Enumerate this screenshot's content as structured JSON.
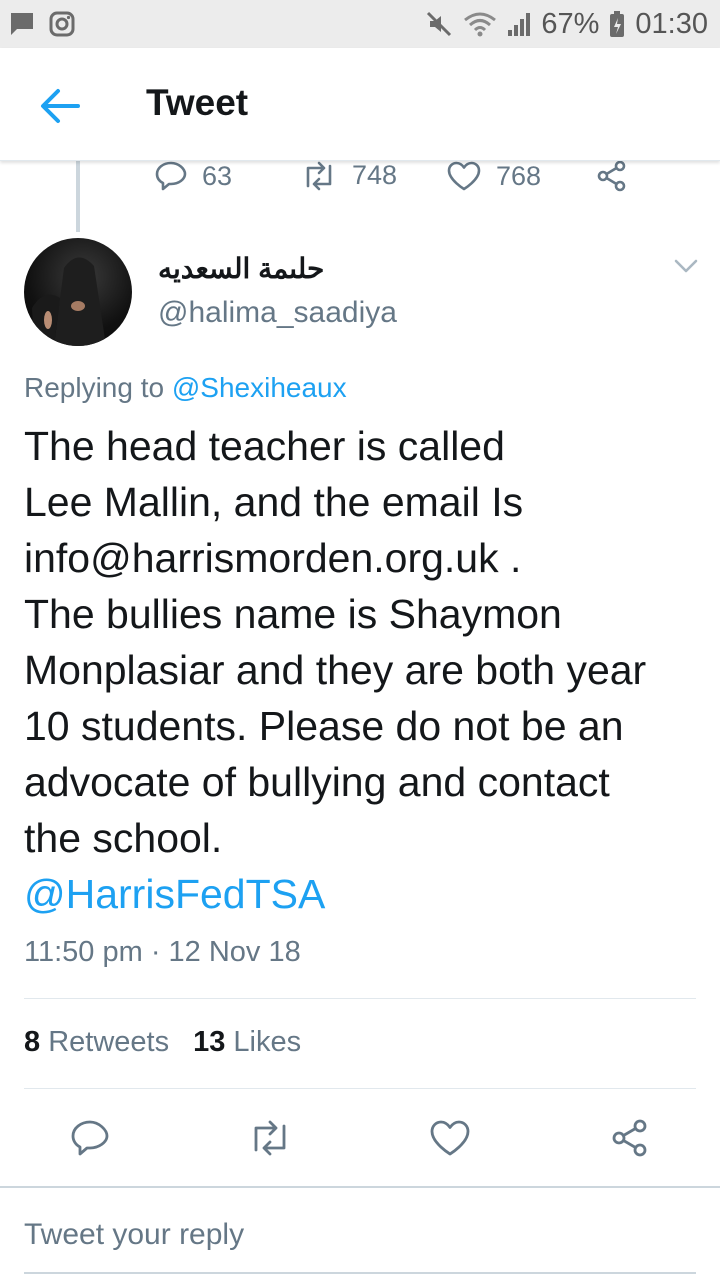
{
  "status_bar": {
    "battery": "67%",
    "time": "01:30",
    "icons": [
      "message-icon",
      "instagram-icon",
      "mute-icon",
      "wifi-icon",
      "signal-icon",
      "battery-icon"
    ]
  },
  "app_bar": {
    "title": "Tweet"
  },
  "previous_tweet_actions": {
    "replies": "63",
    "retweets": "748",
    "likes": "768"
  },
  "tweet": {
    "author_name": "حلىمة السعديه",
    "author_handle": "@halima_saadiya",
    "replying_prefix": "Replying to ",
    "replying_to": "@Shexiheaux",
    "body_lines": [
      "The head teacher is called",
      "Lee Mallin, and the email Is",
      "info@harrismorden.org.uk .",
      "The bullies name is Shaymon",
      "Monplasiar and they are both year",
      "10 students. Please do not be an",
      "advocate of bullying and contact",
      "the school."
    ],
    "mention": "@HarrisFedTSA",
    "timestamp": "11:50 pm · 12 Nov 18",
    "retweet_count": "8",
    "retweet_label": "Retweets",
    "like_count": "13",
    "like_label": "Likes"
  },
  "reply": {
    "placeholder": "Tweet your reply"
  },
  "colors": {
    "accent": "#1da1f2",
    "muted": "#657786",
    "text": "#14171a",
    "divider": "#e1e8ed"
  }
}
